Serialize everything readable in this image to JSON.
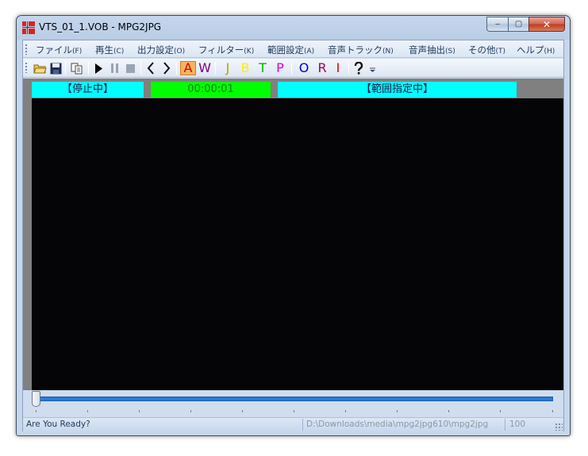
{
  "window": {
    "title": "VTS_01_1.VOB - MPG2JPG",
    "controls": {
      "minimize": "‒",
      "maximize": "▢",
      "close": "✕"
    }
  },
  "menu": [
    {
      "label": "ファイル",
      "accel": "(F)"
    },
    {
      "label": "再生",
      "accel": "(C)"
    },
    {
      "label": "出力設定",
      "accel": "(O)"
    },
    {
      "label": "フィルター",
      "accel": "(K)"
    },
    {
      "label": "範囲設定",
      "accel": "(A)"
    },
    {
      "label": "音声トラック",
      "accel": "(N)"
    },
    {
      "label": "音声抽出",
      "accel": "(S)"
    },
    {
      "label": "その他",
      "accel": "(T)"
    },
    {
      "label": "ヘルプ",
      "accel": "(H)"
    }
  ],
  "toolbar": {
    "letters": [
      {
        "glyph": "A",
        "color": "#d60000"
      },
      {
        "glyph": "W",
        "color": "#800080"
      },
      {
        "glyph": "J",
        "color": "#b5a300"
      },
      {
        "glyph": "B",
        "color": "#ffee00"
      },
      {
        "glyph": "T",
        "color": "#00b400"
      },
      {
        "glyph": "P",
        "color": "#e000e0"
      },
      {
        "glyph": "O",
        "color": "#0000e0"
      },
      {
        "glyph": "R",
        "color": "#a00060"
      },
      {
        "glyph": "I",
        "color": "#e00000"
      }
    ],
    "icons": [
      "open-folder-icon",
      "save-icon",
      "copy-icon",
      "play-icon",
      "pause-icon",
      "stop-icon",
      "prev-icon",
      "next-icon",
      "help-icon"
    ]
  },
  "status_labels": {
    "state": "【停止中】",
    "time": "00:00:01",
    "range": "【範囲指定中】"
  },
  "colors": {
    "state_bg": "#00ffff",
    "time_bg": "#00ff00",
    "time_fg": "#0a7a0a",
    "range_bg": "#00ffff",
    "accent": "#2b7bd4"
  },
  "seek": {
    "position_fraction": 0.0
  },
  "statusbar": {
    "message": "Are You Ready?",
    "path": "D:\\Downloads\\media\\mpg2jpg610\\mpg2jpg",
    "value": "100"
  }
}
